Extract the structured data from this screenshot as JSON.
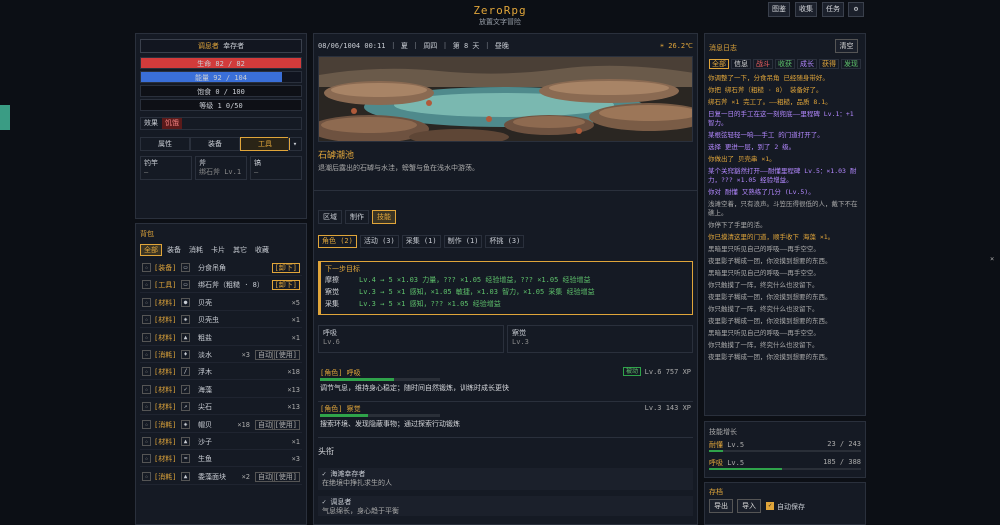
{
  "header": {
    "title": "ZeroRpg",
    "subtitle": "放置文字冒险",
    "buttons": [
      "图鉴",
      "收集",
      "任务"
    ]
  },
  "status": {
    "title_label": "调息者",
    "title_name": "幸存者",
    "hp": "生命 82 / 82",
    "hp_pct": 1.0,
    "energy": "能量 92 / 104",
    "energy_pct": 0.88,
    "hunger": "饱食 0 / 100",
    "level": "等级 1 0/50",
    "effect_label": "效果",
    "effect_tag": "饥饿",
    "tabs": [
      "属性",
      "装备",
      "工具"
    ],
    "slots": [
      {
        "k": "钓竿",
        "v": "—"
      },
      {
        "k": "斧",
        "v": "绑石斧 Lv.1"
      },
      {
        "k": "镐",
        "v": "—"
      }
    ]
  },
  "bag": {
    "title": "背包",
    "tabs": [
      "全部",
      "装备",
      "消耗",
      "卡片",
      "其它",
      "收藏"
    ],
    "items": [
      {
        "cat": "[装备]",
        "ic": "▭",
        "name": "分食吊角",
        "q": "",
        "btn": "[卸下]"
      },
      {
        "cat": "[工具]",
        "ic": "▭",
        "name": "绑石斧（粗糙 · 8）",
        "q": "",
        "btn": "[卸下]"
      },
      {
        "cat": "[材料]",
        "ic": "●",
        "name": "贝壳",
        "q": "×5",
        "btn": ""
      },
      {
        "cat": "[材料]",
        "ic": "◈",
        "name": "贝壳虫",
        "q": "×1",
        "btn": ""
      },
      {
        "cat": "[材料]",
        "ic": "▲",
        "name": "粗盐",
        "q": "×1",
        "btn": ""
      },
      {
        "cat": "[消耗]",
        "ic": "♦",
        "name": "淡水",
        "q": "×3",
        "btn": "[使用]",
        "auto": "自动"
      },
      {
        "cat": "[材料]",
        "ic": "/",
        "name": "浮木",
        "q": "×18",
        "btn": ""
      },
      {
        "cat": "[材料]",
        "ic": "✓",
        "name": "海藻",
        "q": "×13",
        "btn": ""
      },
      {
        "cat": "[材料]",
        "ic": "↗",
        "name": "尖石",
        "q": "×13",
        "btn": ""
      },
      {
        "cat": "[消耗]",
        "ic": "◈",
        "name": "帽贝",
        "q": "×18",
        "btn": "[使用]",
        "auto": "自动"
      },
      {
        "cat": "[材料]",
        "ic": "▲",
        "name": "沙子",
        "q": "×1",
        "btn": ""
      },
      {
        "cat": "[材料]",
        "ic": "≈",
        "name": "生鱼",
        "q": "×3",
        "btn": ""
      },
      {
        "cat": "[消耗]",
        "ic": "▲",
        "name": "委藻面块",
        "q": "×2",
        "btn": "[使用]",
        "auto": "自动"
      }
    ]
  },
  "main": {
    "date": "08/06/1004 00:11",
    "season": "夏",
    "weekday": "周四",
    "day": "第 8 天",
    "weather": "昼晚",
    "temp": "26.2℃",
    "location_name": "石罅潮池",
    "location_desc": "退潮后露出的石罅与水洼，螃蟹与鱼在浅水中游荡。",
    "tabs": [
      "区域",
      "制作",
      "技能"
    ],
    "subtabs": [
      "角色 (2)",
      "活动 (3)",
      "采集 (1)",
      "制作 (1)",
      "杯挑 (3)"
    ],
    "goal": {
      "title": "下一步目标",
      "rows": [
        {
          "k": "摩擦",
          "v": "Lv.4 → 5 ×1.03 力量，??? ×1.05 经验增益，??? ×1.05 经验增益"
        },
        {
          "k": "察觉",
          "v": "Lv.3 → 5 ×1 感知，×1.05 敏捷，×1.03 智力，×1.05 采集 经验增益"
        },
        {
          "k": "采集",
          "v": "Lv.3 → 5 ×1 感知，??? ×1.05 经验增益"
        }
      ]
    },
    "skillboxes": [
      {
        "t": "呼吸",
        "v": "Lv.6"
      },
      {
        "t": "察觉",
        "v": "Lv.3"
      }
    ],
    "skills": [
      {
        "t": "[角色] 呼吸",
        "lv": "Lv.6 757 XP",
        "auto": "被动",
        "desc": "调节气息，维持身心稳定；随时间自然锻炼，训练时成长更快",
        "p": 0.62
      },
      {
        "t": "[角色] 察觉",
        "lv": "Lv.3 143 XP",
        "auto": "",
        "desc": "搜索环境、发现隐蔽事物；通过探索行动锻炼",
        "p": 0.4
      }
    ],
    "section": "头衔",
    "titles": [
      {
        "t": "✓ 海滩幸存者",
        "d": "在绝境中挣扎求生的人"
      },
      {
        "t": "✓ 调息者",
        "d": "气息绵长，身心趋于平衡"
      }
    ]
  },
  "log": {
    "title": "消息日志",
    "clear": "清空",
    "tabs": [
      "全部",
      "信息",
      "战斗",
      "收获",
      "成长",
      "获得",
      "发现"
    ],
    "lines": [
      {
        "t": "你调整了一下，分食吊角 已经随身带好。",
        "c": "#e0a53a"
      },
      {
        "t": "你把 绑石斧（粗糙 · 8） 装备好了。",
        "c": "#e0a53a"
      },
      {
        "t": "绑石斧 ×1 完工了。——粗糙，品质 8.1。",
        "c": "#e0a53a"
      },
      {
        "t": "日复一日的手工在这一刻兜底——里程碑 Lv.1：+1 智力。",
        "c": "#b388ff"
      },
      {
        "t": "某根弦轻轻一响——手工 的门道打开了。",
        "c": "#b388ff"
      },
      {
        "t": "选择 更进一层，到了 2 级。",
        "c": "#b388ff"
      },
      {
        "t": "你做出了 贝壳串 ×1。",
        "c": "#e0a53a"
      },
      {
        "t": "某个关窍豁然打开——耐懂里程碑 Lv.5：×1.03 耐力，??? ×1.05 经验增益。",
        "c": "#b388ff"
      },
      {
        "t": "你对 耐懂 又熟练了几分 (Lv.5)。",
        "c": "#b388ff"
      },
      {
        "t": "浅滩空着，只有浪声。斗笠压得很低的人，戴下不在礁上。",
        "c": "#aaa"
      },
      {
        "t": "你停下了手里的活。",
        "c": "#aaa"
      },
      {
        "t": "你已摸清这里的门道，顺手收下 海藻 ×1。",
        "c": "#e0a53a"
      },
      {
        "t": "黑暗里只听见自己的呼吸——再手空空。",
        "c": "#aaa"
      },
      {
        "t": "夜里影子糊成一团，你没摸到想要的东西。",
        "c": "#aaa"
      },
      {
        "t": "黑暗里只听见自己的呼吸——再手空空。",
        "c": "#aaa"
      },
      {
        "t": "你只触摸了一阵，终究什么也没留下。",
        "c": "#aaa"
      },
      {
        "t": "夜里影子糊成一团，你没摸到想要的东西。",
        "c": "#aaa"
      },
      {
        "t": "你只触摸了一阵，终究什么也没留下。",
        "c": "#aaa"
      },
      {
        "t": "夜里影子糊成一团，你没摸到想要的东西。",
        "c": "#aaa"
      },
      {
        "t": "黑暗里只听见自己的呼吸——再手空空。",
        "c": "#aaa"
      },
      {
        "t": "你只触摸了一阵，终究什么也没留下。",
        "c": "#aaa"
      },
      {
        "t": "夜里影子糊成一团，你没摸到想要的东西。",
        "c": "#aaa"
      }
    ]
  },
  "growth": {
    "title": "技能增长",
    "rows": [
      {
        "n": "耐懂",
        "lv": "Lv.5",
        "v": "23 / 243",
        "p": 0.09
      },
      {
        "n": "呼吸",
        "lv": "Lv.5",
        "v": "185 / 388",
        "p": 0.48
      }
    ]
  },
  "save": {
    "title": "存档",
    "export": "导出",
    "import": "导入",
    "auto": "自动保存"
  }
}
